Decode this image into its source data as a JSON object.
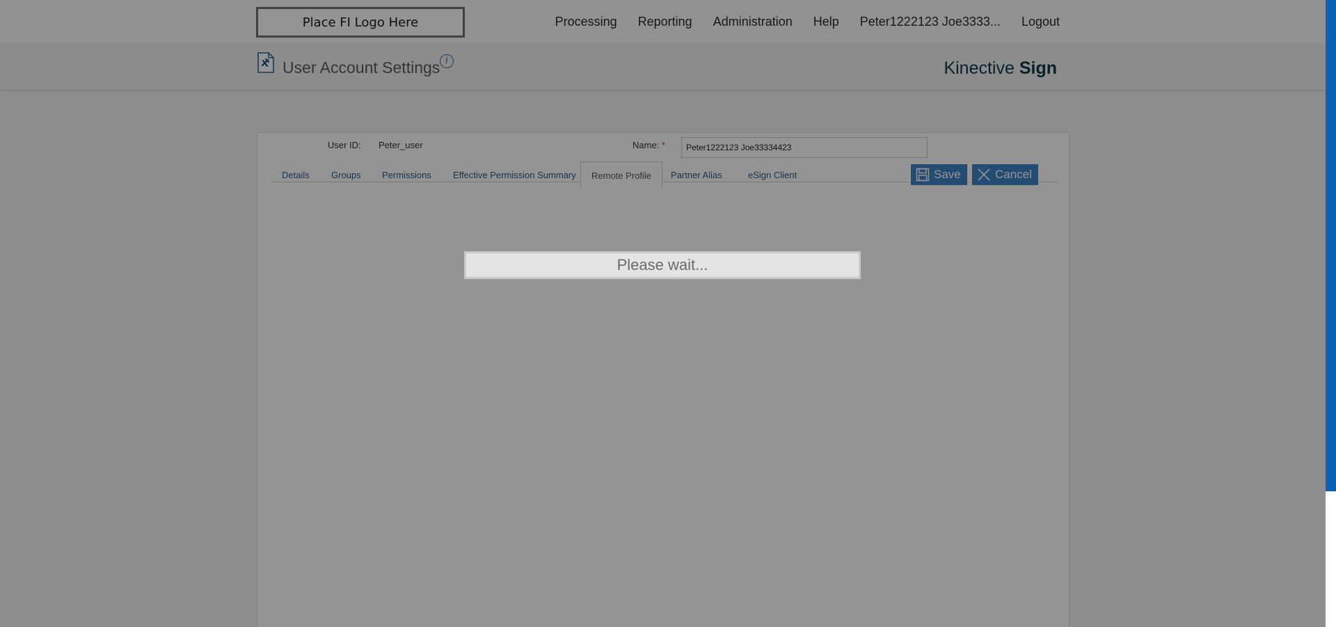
{
  "nav": {
    "logo": "Place FI Logo Here",
    "links": [
      "Processing",
      "Reporting",
      "Administration",
      "Help",
      "Peter1222123 Joe3333...",
      "Logout"
    ]
  },
  "header": {
    "title": "User Account Settings",
    "info": "i",
    "brand_regular": "Kinective ",
    "brand_bold": "Sign"
  },
  "form": {
    "user_id_label": "User ID:",
    "user_id_value": "Peter_user",
    "name_label": "Name:",
    "name_required": "*",
    "name_value": "Peter1222123 Joe33334423"
  },
  "tabs": [
    {
      "label": "Details"
    },
    {
      "label": "Groups"
    },
    {
      "label": "Permissions"
    },
    {
      "label": "Effective Permission Summary"
    },
    {
      "label": "Remote Profile"
    },
    {
      "label": "Partner Alias"
    },
    {
      "label": "eSign Client"
    }
  ],
  "active_tab": "Remote Profile",
  "buttons": {
    "save": "Save",
    "cancel": "Cancel"
  },
  "loading": {
    "message": "Please wait..."
  },
  "colors": {
    "accent": "#3e82c4",
    "link": "#1f5a8c",
    "brand": "#0b3b48",
    "scrollbar": "#0a62b6"
  }
}
